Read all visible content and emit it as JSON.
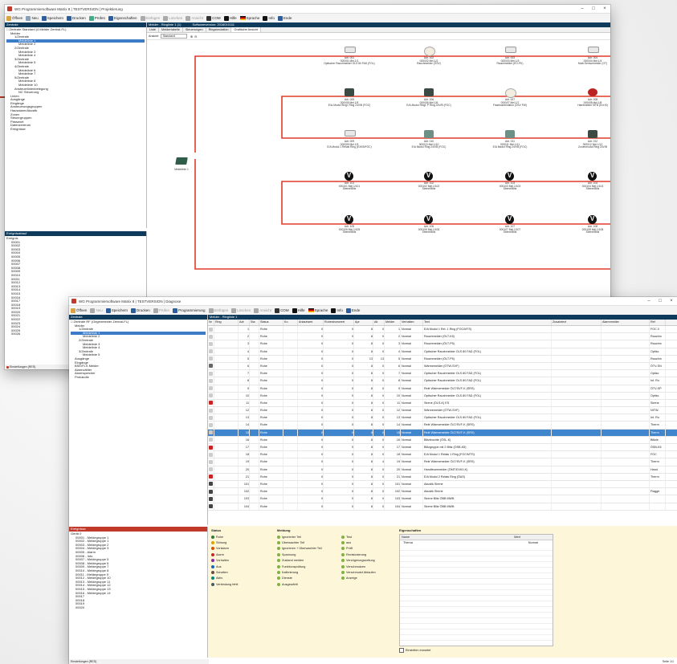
{
  "win1": {
    "title": "WG Programmiersoftware Matrix 8 | TESTVERSION | Projektierung",
    "toolbar": [
      {
        "label": "Öffnen",
        "color": "#d9a441",
        "disabled": false
      },
      {
        "label": "Neu",
        "color": "#8aa0b8",
        "disabled": false
      },
      {
        "label": "Speichern",
        "color": "#2e5d9b",
        "disabled": false
      },
      {
        "label": "Drucken",
        "color": "#2e5d9b",
        "disabled": false
      },
      {
        "label": "Prüfen",
        "color": "#4a8",
        "disabled": false
      },
      {
        "label": "Eigenschaften",
        "color": "#2e5d9b",
        "disabled": false
      },
      {
        "label": "Einfügen",
        "color": "#aaa",
        "disabled": true
      },
      {
        "label": "Löschen",
        "color": "#aaa",
        "disabled": true
      },
      {
        "label": "Ansicht",
        "color": "#aaa",
        "disabled": true
      },
      {
        "label": "COM",
        "color": "#333",
        "disabled": false
      },
      {
        "label": "Hilfe",
        "color": "#111",
        "disabled": false
      },
      {
        "label": "Sprache",
        "color": "flag",
        "disabled": false
      },
      {
        "label": "Info",
        "color": "#111",
        "disabled": false
      },
      {
        "label": "Ende",
        "color": "#2e5d9b",
        "disabled": false
      }
    ],
    "left_header": "Zentrale",
    "tree": [
      {
        "t": "Zentrale Standard (4 Melder Zentral-FL)",
        "i": 0
      },
      {
        "t": "Melder",
        "i": 1
      },
      {
        "t": "1/Zentrale",
        "i": 2
      },
      {
        "t": "Meldelinie 1",
        "i": 3,
        "sel": true
      },
      {
        "t": "Meldelinie 2",
        "i": 3
      },
      {
        "t": "2/Zentrale",
        "i": 2
      },
      {
        "t": "Meldelinie 3",
        "i": 3
      },
      {
        "t": "Meldelinie 4",
        "i": 3
      },
      {
        "t": "3/Zentrale",
        "i": 2
      },
      {
        "t": "Meldelinie 5",
        "i": 3
      },
      {
        "t": "4/Zentrale",
        "i": 2
      },
      {
        "t": "Meldelinie 6",
        "i": 3
      },
      {
        "t": "Meldelinie 7",
        "i": 3
      },
      {
        "t": "5/Zentrale",
        "i": 2
      },
      {
        "t": "Meldelinie 8",
        "i": 3
      },
      {
        "t": "Meldelinie 10",
        "i": 3
      },
      {
        "t": "Ansteuerlinienbelegung",
        "i": 2
      },
      {
        "t": "NC Steuerung",
        "i": 3
      },
      {
        "t": "Linien",
        "i": 1
      },
      {
        "t": "Ausgänge",
        "i": 1
      },
      {
        "t": "Eingänge",
        "i": 1
      },
      {
        "t": "Ansteuerungsgruppen",
        "i": 1
      },
      {
        "t": "Hausalarm/Akustik",
        "i": 1
      },
      {
        "t": "Zonen",
        "i": 1
      },
      {
        "t": "Steuergruppen",
        "i": 1
      },
      {
        "t": "Passwort",
        "i": 1
      },
      {
        "t": "Datenzentrum",
        "i": 1
      },
      {
        "t": "Ereignisse",
        "i": 1
      }
    ],
    "lower_header": "Ereignisablauf",
    "lower_tree": [
      "Ereignis",
      "00001",
      "00002",
      "00003",
      "00004",
      "00005",
      "00006",
      "00007",
      "00008",
      "00009",
      "00010",
      "00011",
      "00012",
      "00013",
      "00014",
      "00015",
      "00016",
      "00017",
      "00018",
      "00019",
      "00020",
      "00021",
      "00022",
      "00023",
      "00024",
      "00025",
      "00026"
    ],
    "status": "Einstellungen (RES)",
    "main_header": "Melder - Ringlinie 1 (1)",
    "main_header2": "Softwareversion: 2016010111",
    "tabs": [
      "Liste",
      "Meldertabelle",
      "Steuerungen",
      "Ringsimulation",
      "Grafische Ansicht"
    ],
    "active_tab": 4,
    "view_label": "Ansicht",
    "view_value": "Standard",
    "side_node": "Meldelinie 1",
    "nodes": [
      {
        "lbl": "Adr. 001\n000001 Mel.1/1\nOptischer Rauchmelder OLS 80 FAD (FOL)",
        "kind": "white"
      },
      {
        "lbl": "Adr. 002\n000002 Mel.1/2\nRauchmelder (ÖSV)",
        "kind": "round"
      },
      {
        "lbl": "Adr. 003\n000003 Mel.1/3\nRauchmelder (EO-PK)",
        "kind": "white"
      },
      {
        "lbl": "Adr. 004\n000004 Mel.1/4\nMulti-Sensormelder (OT)",
        "kind": "white"
      },
      {
        "lbl": "Adr. 005\n000005 Mel.1/5\nE/A-Modul Ringl. Ring 24V/B (FOC)",
        "kind": "dark"
      },
      {
        "lbl": "Adr. 006\n000006 Mel.1/6\nE/A-Modul Ringl. P Ring 24V/B (FOC)",
        "kind": "dark"
      },
      {
        "lbl": "Adr. 007\n000007 Mel.1/7\nFlashkombination (OSV FW)",
        "kind": "round"
      },
      {
        "lbl": "Adr. 008\n000008 Mel.1/8\nHandmelder MTB (Ext.Kl)",
        "kind": "red"
      },
      {
        "lbl": "Adr. 009\n000009 Mel.1/9\nE/A Modul 1 Relais Ring (EXKB/FOC)",
        "kind": "white"
      },
      {
        "lbl": "Adr. 010\n000010 Mel.1/10\nE/A Modul Ring 24V/B (FOC)",
        "kind": "module"
      },
      {
        "lbl": "Adr. 011\n000011 Mel.1/11\nE/A Modul Ring 24V/B (FOC)",
        "kind": "module"
      },
      {
        "lbl": "Adr. 012\n000012 Mel.1/12\nZonenmodul Ring 24V/B",
        "kind": "dark"
      },
      {
        "lbl": "Adr. 101\n000101 Mel.1/101\nSirene/Blitz",
        "kind": "v"
      },
      {
        "lbl": "Adr. 102\n000102 Mel.1/102\nSirene/Blitz",
        "kind": "v"
      },
      {
        "lbl": "Adr. 103\n000103 Mel.1/103\nSirene/Blitz",
        "kind": "v"
      },
      {
        "lbl": "Adr. 104\n000104 Mel.1/104\nSirene/Blitz",
        "kind": "v"
      },
      {
        "lbl": "Adr. 105\n000105 Mel.1/105\nSirene/Blitz",
        "kind": "v"
      },
      {
        "lbl": "Adr. 106\n000106 Mel.1/106\nSirene/Blitz",
        "kind": "v"
      },
      {
        "lbl": "Adr. 107\n000107 Mel.1/107\nSirene/Blitz",
        "kind": "v"
      },
      {
        "lbl": "Adr. 108\n000108 Mel.1/108\nSirene/Blitz",
        "kind": "v"
      }
    ]
  },
  "win2": {
    "title": "WG Programmiersoftware Matrix 8 | TESTVERSION | Diagnose",
    "toolbar": [
      {
        "label": "Öffnen",
        "color": "#d9a441",
        "disabled": false
      },
      {
        "label": "Neu",
        "color": "#aaa",
        "disabled": true
      },
      {
        "label": "Speichern",
        "color": "#2e5d9b",
        "disabled": false
      },
      {
        "label": "Drucken",
        "color": "#2e5d9b",
        "disabled": false
      },
      {
        "label": "Prüfen",
        "color": "#aaa",
        "disabled": true
      },
      {
        "label": "Programmierung",
        "color": "#2e5d9b",
        "disabled": false
      },
      {
        "label": "Einfügen",
        "color": "#aaa",
        "disabled": true
      },
      {
        "label": "Löschen",
        "color": "#aaa",
        "disabled": true
      },
      {
        "label": "Ansicht",
        "color": "#aaa",
        "disabled": true
      },
      {
        "label": "COM",
        "color": "#333",
        "disabled": false
      },
      {
        "label": "Hilfe",
        "color": "#111",
        "disabled": false
      },
      {
        "label": "Sprache",
        "color": "flag",
        "disabled": false
      },
      {
        "label": "Info",
        "color": "#111",
        "disabled": false
      },
      {
        "label": "Ende",
        "color": "#2e5d9b",
        "disabled": false
      }
    ],
    "left_header": "Zentrale",
    "tree": [
      {
        "t": "Zentrale RF (Gegenmelder Zentral-FL)",
        "i": 0
      },
      {
        "t": "Melder",
        "i": 1
      },
      {
        "t": "1/Zentrale",
        "i": 2
      },
      {
        "t": "Meldelinie 1",
        "i": 3,
        "sel": true
      },
      {
        "t": "Meldelinie 2",
        "i": 3
      },
      {
        "t": "2/Zentrale",
        "i": 2
      },
      {
        "t": "Meldelinie 3",
        "i": 3
      },
      {
        "t": "Meldelinie 4",
        "i": 3
      },
      {
        "t": "3/Zentrale",
        "i": 2
      },
      {
        "t": "Meldelinie 5",
        "i": 3
      },
      {
        "t": "Ausgänge",
        "i": 1
      },
      {
        "t": "Eingänge",
        "i": 1
      },
      {
        "t": "BSE/FLS Melder",
        "i": 1
      },
      {
        "t": "Alarmzähler",
        "i": 1
      },
      {
        "t": "Alarmspeicher",
        "i": 1
      },
      {
        "t": "Protokolle",
        "i": 1
      }
    ],
    "lower_header": "Ereignisse",
    "lower_tree": [
      "Gerät 0",
      "00001 - Meldegruppe 1",
      "00002 - Meldegruppe 1",
      "00003 - Meldegruppe 2",
      "00004 - Meldegruppe 3",
      "00005 - Alarm",
      "00006 - Info",
      "00007 - Meldegruppe 5",
      "00008 - Meldegruppe 6",
      "00009 - Meldegruppe 7",
      "00010 - Meldegruppe 8",
      "00011 - Meldegruppe 9",
      "00012 - Meldegruppe 10",
      "00013 - Meldegruppe 11",
      "00014 - Meldegruppe 12",
      "00015 - Meldegruppe 13",
      "00016 - Meldegruppe 14",
      "00017",
      "00018",
      "00019",
      "00020"
    ],
    "status": "Einstellungen (RES)",
    "page_counter": "Seite 1/1",
    "grid_header": "Melder - Ringlinie 1",
    "columns": [
      "Nr",
      "Ring",
      "Adr",
      "Sta",
      "Status",
      "Ko",
      "Anlaufwert",
      "Ruhestromwert",
      "Apr",
      "Alt",
      "Melder",
      "Verhalten",
      "Text",
      "Zusatztext",
      "Alarmmelder",
      "Ref"
    ],
    "rows": [
      {
        "ico": "#cccccc",
        "adr": "1",
        "st": "Ruhe",
        "v1": "0",
        "v2": "0",
        "v3": "8",
        "v4": "0",
        "n": "1",
        "ty": "Normal",
        "text": "E/A Modul 1 Rel. 1 Ring (FOC/MTS)",
        "ref": "FOC 0"
      },
      {
        "ico": "#cccccc",
        "adr": "2",
        "st": "Ruhe",
        "v1": "0",
        "v2": "0",
        "v3": "8",
        "v4": "0",
        "n": "2",
        "ty": "Normal",
        "text": "Rauchmelder (ÖLT-K5)",
        "ref": "Rauchm"
      },
      {
        "ico": "#cccccc",
        "adr": "3",
        "st": "Ruhe",
        "v1": "0",
        "v2": "0",
        "v3": "8",
        "v4": "0",
        "n": "3",
        "ty": "Normal",
        "text": "Rauchmelder (ÖLT-P5)",
        "ref": "Rauchm"
      },
      {
        "ico": "#cccccc",
        "adr": "4",
        "st": "Ruhe",
        "v1": "0",
        "v2": "0",
        "v3": "8",
        "v4": "0",
        "n": "4",
        "ty": "Normal",
        "text": "Optischer Rauchmelder OLS 80 FAD (FOL)",
        "ref": "Optisc"
      },
      {
        "ico": "#cccccc",
        "adr": "5",
        "st": "Ruhe",
        "v1": "0",
        "v2": "0",
        "v3": "13",
        "v4": "13",
        "n": "5",
        "ty": "Normal",
        "text": "Rauchmelder (ÖLT-P5)",
        "ref": "Rauchm"
      },
      {
        "ico": "#666666",
        "adr": "6",
        "st": "Ruhe",
        "v1": "0",
        "v2": "0",
        "v3": "8",
        "v4": "0",
        "n": "6",
        "ty": "Normal",
        "text": "Wärmemelder (ÖTW-SVF)",
        "ref": "ÖTV-SN"
      },
      {
        "ico": "#cccccc",
        "adr": "7",
        "st": "Ruhe",
        "v1": "0",
        "v2": "0",
        "v3": "8",
        "v4": "0",
        "n": "7",
        "ty": "Normal",
        "text": "Optischer Rauchmelder OLS 80 FAD (FOL)",
        "ref": "Optisc"
      },
      {
        "ico": "#cccccc",
        "adr": "8",
        "st": "Ruhe",
        "v1": "0",
        "v2": "0",
        "v3": "8",
        "v4": "0",
        "n": "8",
        "ty": "Normal",
        "text": "Optischer Rauchmelder OLS 80 FAD (FOL)",
        "ref": "Int. Ro"
      },
      {
        "ico": "#cccccc",
        "adr": "9",
        "st": "Ruhe",
        "v1": "0",
        "v2": "0",
        "v3": "8",
        "v4": "0",
        "n": "9",
        "ty": "Normal",
        "text": "Relé Wärmemelder ÖLT/SVF-K (SRS)",
        "ref": "ÖTV-SP"
      },
      {
        "ico": "#cccccc",
        "adr": "10",
        "st": "Ruhe",
        "v1": "0",
        "v2": "0",
        "v3": "8",
        "v4": "0",
        "n": "10",
        "ty": "Normal",
        "text": "Optischer Rauchmelder OLS 80 FAD (FOL)",
        "ref": "Optisc"
      },
      {
        "ico": "#cc2222",
        "adr": "11",
        "st": "Ruhe",
        "v1": "0",
        "v2": "0",
        "v3": "8",
        "v4": "0",
        "n": "11",
        "ty": "Normal",
        "text": "Sirene (ÖLS-K) ES",
        "ref": "Sirene"
      },
      {
        "ico": "#cccccc",
        "adr": "12",
        "st": "Ruhe",
        "v1": "0",
        "v2": "0",
        "v3": "8",
        "v4": "0",
        "n": "12",
        "ty": "Normal",
        "text": "Wärmemelder (ÖTW-SVF)",
        "ref": "NITW-"
      },
      {
        "ico": "#cccccc",
        "adr": "13",
        "st": "Ruhe",
        "v1": "0",
        "v2": "0",
        "v3": "8",
        "v4": "0",
        "n": "13",
        "ty": "Normal",
        "text": "Optischer Rauchmelder OLS 80 FAD (FOL)",
        "ref": "Int. Ro"
      },
      {
        "ico": "#cccccc",
        "adr": "14",
        "st": "Ruhe",
        "v1": "0",
        "v2": "0",
        "v3": "8",
        "v4": "0",
        "n": "14",
        "ty": "Normal",
        "text": "Relé Wärmemelder ÖLT/SVF-K (SRS)",
        "ref": "Therm"
      },
      {
        "ico": "#cccccc",
        "adr": "15",
        "st": "Ruhe",
        "v1": "0",
        "v2": "0",
        "v3": "8",
        "v4": "0",
        "n": "15",
        "ty": "Normal",
        "text": "Relé Wärmemelder ÖLT/SVF-K (SRS)",
        "ref": "Therm",
        "sel": true
      },
      {
        "ico": "#cccccc",
        "adr": "16",
        "st": "Ruhe",
        "v1": "0",
        "v2": "0",
        "v3": "8",
        "v4": "0",
        "n": "16",
        "ty": "Normal",
        "text": "Blitzleuchte (ÖSL-K)",
        "ref": "Blitzle"
      },
      {
        "ico": "#cc2222",
        "adr": "17",
        "st": "Ruhe",
        "v1": "0",
        "v2": "0",
        "v3": "8",
        "v4": "0",
        "n": "17",
        "ty": "Normal",
        "text": "Blitzgruppe mit 2 Blitz (ÖSB-K5)",
        "ref": "ÖSB-K5"
      },
      {
        "ico": "#cccccc",
        "adr": "18",
        "st": "Ruhe",
        "v1": "0",
        "v2": "0",
        "v3": "8",
        "v4": "0",
        "n": "18",
        "ty": "Normal",
        "text": "E/A Modul 1 Relais 1 Ring (FOC/MTS)",
        "ref": "FOC"
      },
      {
        "ico": "#cccccc",
        "adr": "19",
        "st": "Ruhe",
        "v1": "0",
        "v2": "0",
        "v3": "8",
        "v4": "4",
        "n": "19",
        "ty": "Normal",
        "text": "Relé Wärmemelder ÖLT/SVF-K (SRS)",
        "ref": "Therm"
      },
      {
        "ico": "#cccccc",
        "adr": "20",
        "st": "Ruhe",
        "v1": "0",
        "v2": "0",
        "v3": "8",
        "v4": "0",
        "n": "20",
        "ty": "Normal",
        "text": "Handfeuermelder (ÖMT/EXK0-K)",
        "ref": "Hand"
      },
      {
        "ico": "#cc2222",
        "adr": "21",
        "st": "Ruhe",
        "v1": "0",
        "v2": "0",
        "v3": "8",
        "v4": "0",
        "n": "21",
        "ty": "Normal",
        "text": "E/A Modul 2 Relais Ring (ÖAS)",
        "ref": "Therm"
      },
      {
        "ico": "#444444",
        "adr": "101",
        "st": "Ruhe",
        "v1": "0",
        "v2": "0",
        "v3": "8",
        "v4": "0",
        "n": "101",
        "ty": "Normal",
        "text": "Akustik Sirene",
        "ref": ""
      },
      {
        "ico": "#444444",
        "adr": "102",
        "st": "Ruhe",
        "v1": "0",
        "v2": "0",
        "v3": "8",
        "v4": "0",
        "n": "102",
        "ty": "Normal",
        "text": "Akustik Sirene",
        "ref": "Flagge"
      },
      {
        "ico": "#444444",
        "adr": "103",
        "st": "Ruhe",
        "v1": "0",
        "v2": "0",
        "v3": "8",
        "v4": "0",
        "n": "103",
        "ty": "Normal",
        "text": "Sirene Blitz ÖBB MWB",
        "ref": ""
      },
      {
        "ico": "#444444",
        "adr": "104",
        "st": "Ruhe",
        "v1": "0",
        "v2": "0",
        "v3": "8",
        "v4": "0",
        "n": "104",
        "ty": "Normal",
        "text": "Sirene Blitz ÖBB MWB",
        "ref": ""
      }
    ],
    "legend_status_title": "Status",
    "legend_status": [
      {
        "label": "Ruhe",
        "color": "#2e7d32"
      },
      {
        "label": "Störung",
        "color": "#e0a000"
      },
      {
        "label": "Vorlalarm",
        "color": "#d35400"
      },
      {
        "label": "Alarm",
        "color": "#c62828"
      },
      {
        "label": "Vorhalten",
        "color": "#8e24aa"
      },
      {
        "label": "Aus",
        "color": "#1565c0"
      },
      {
        "label": "Schalten",
        "color": "#6d4c41"
      },
      {
        "label": "Aktiv",
        "color": "#00897b"
      },
      {
        "label": "Verbindung fehlt",
        "color": "#455a64"
      }
    ],
    "legend_meldung_title": "Meldung",
    "legend_meldung": [
      {
        "label": "Ignorierter Teil",
        "color": "#7cb342"
      },
      {
        "label": "Überwachter Teil",
        "color": "#7cb342"
      },
      {
        "label": "Ignorieren + Überwachter Teil",
        "color": "#7cb342"
      },
      {
        "label": "Spannung",
        "color": "#7cb342"
      },
      {
        "label": "Zustand melden",
        "color": "#7cb342"
      },
      {
        "label": "Funktionsprüfung",
        "color": "#7cb342"
      },
      {
        "label": "Kalibrierung",
        "color": "#7cb342"
      },
      {
        "label": "Dienste",
        "color": "#7cb342"
      },
      {
        "label": "Ausgewählt",
        "color": "#7cb342"
      }
    ],
    "legend_extra": [
      {
        "label": "Test",
        "color": "#7cb342"
      },
      {
        "label": "aus",
        "color": "#7cb342"
      },
      {
        "label": "Prüft",
        "color": "#7cb342"
      },
      {
        "label": "Revisionierung",
        "color": "#7cb342"
      },
      {
        "label": "Verzögerungszeitung",
        "color": "#7cb342"
      },
      {
        "label": "Verschmutzen",
        "color": "#7cb342"
      },
      {
        "label": "Verschmutzt Ablaufen",
        "color": "#7cb342"
      },
      {
        "label": "Anzeige",
        "color": "#7cb342"
      }
    ],
    "props_title": "Eigenschaften",
    "props_cols": [
      "Name",
      "Wert"
    ],
    "props_rows": [
      {
        "name": "Thema",
        "value": "Normal"
      }
    ],
    "checkbox_label": "Einstellen erwartet"
  }
}
